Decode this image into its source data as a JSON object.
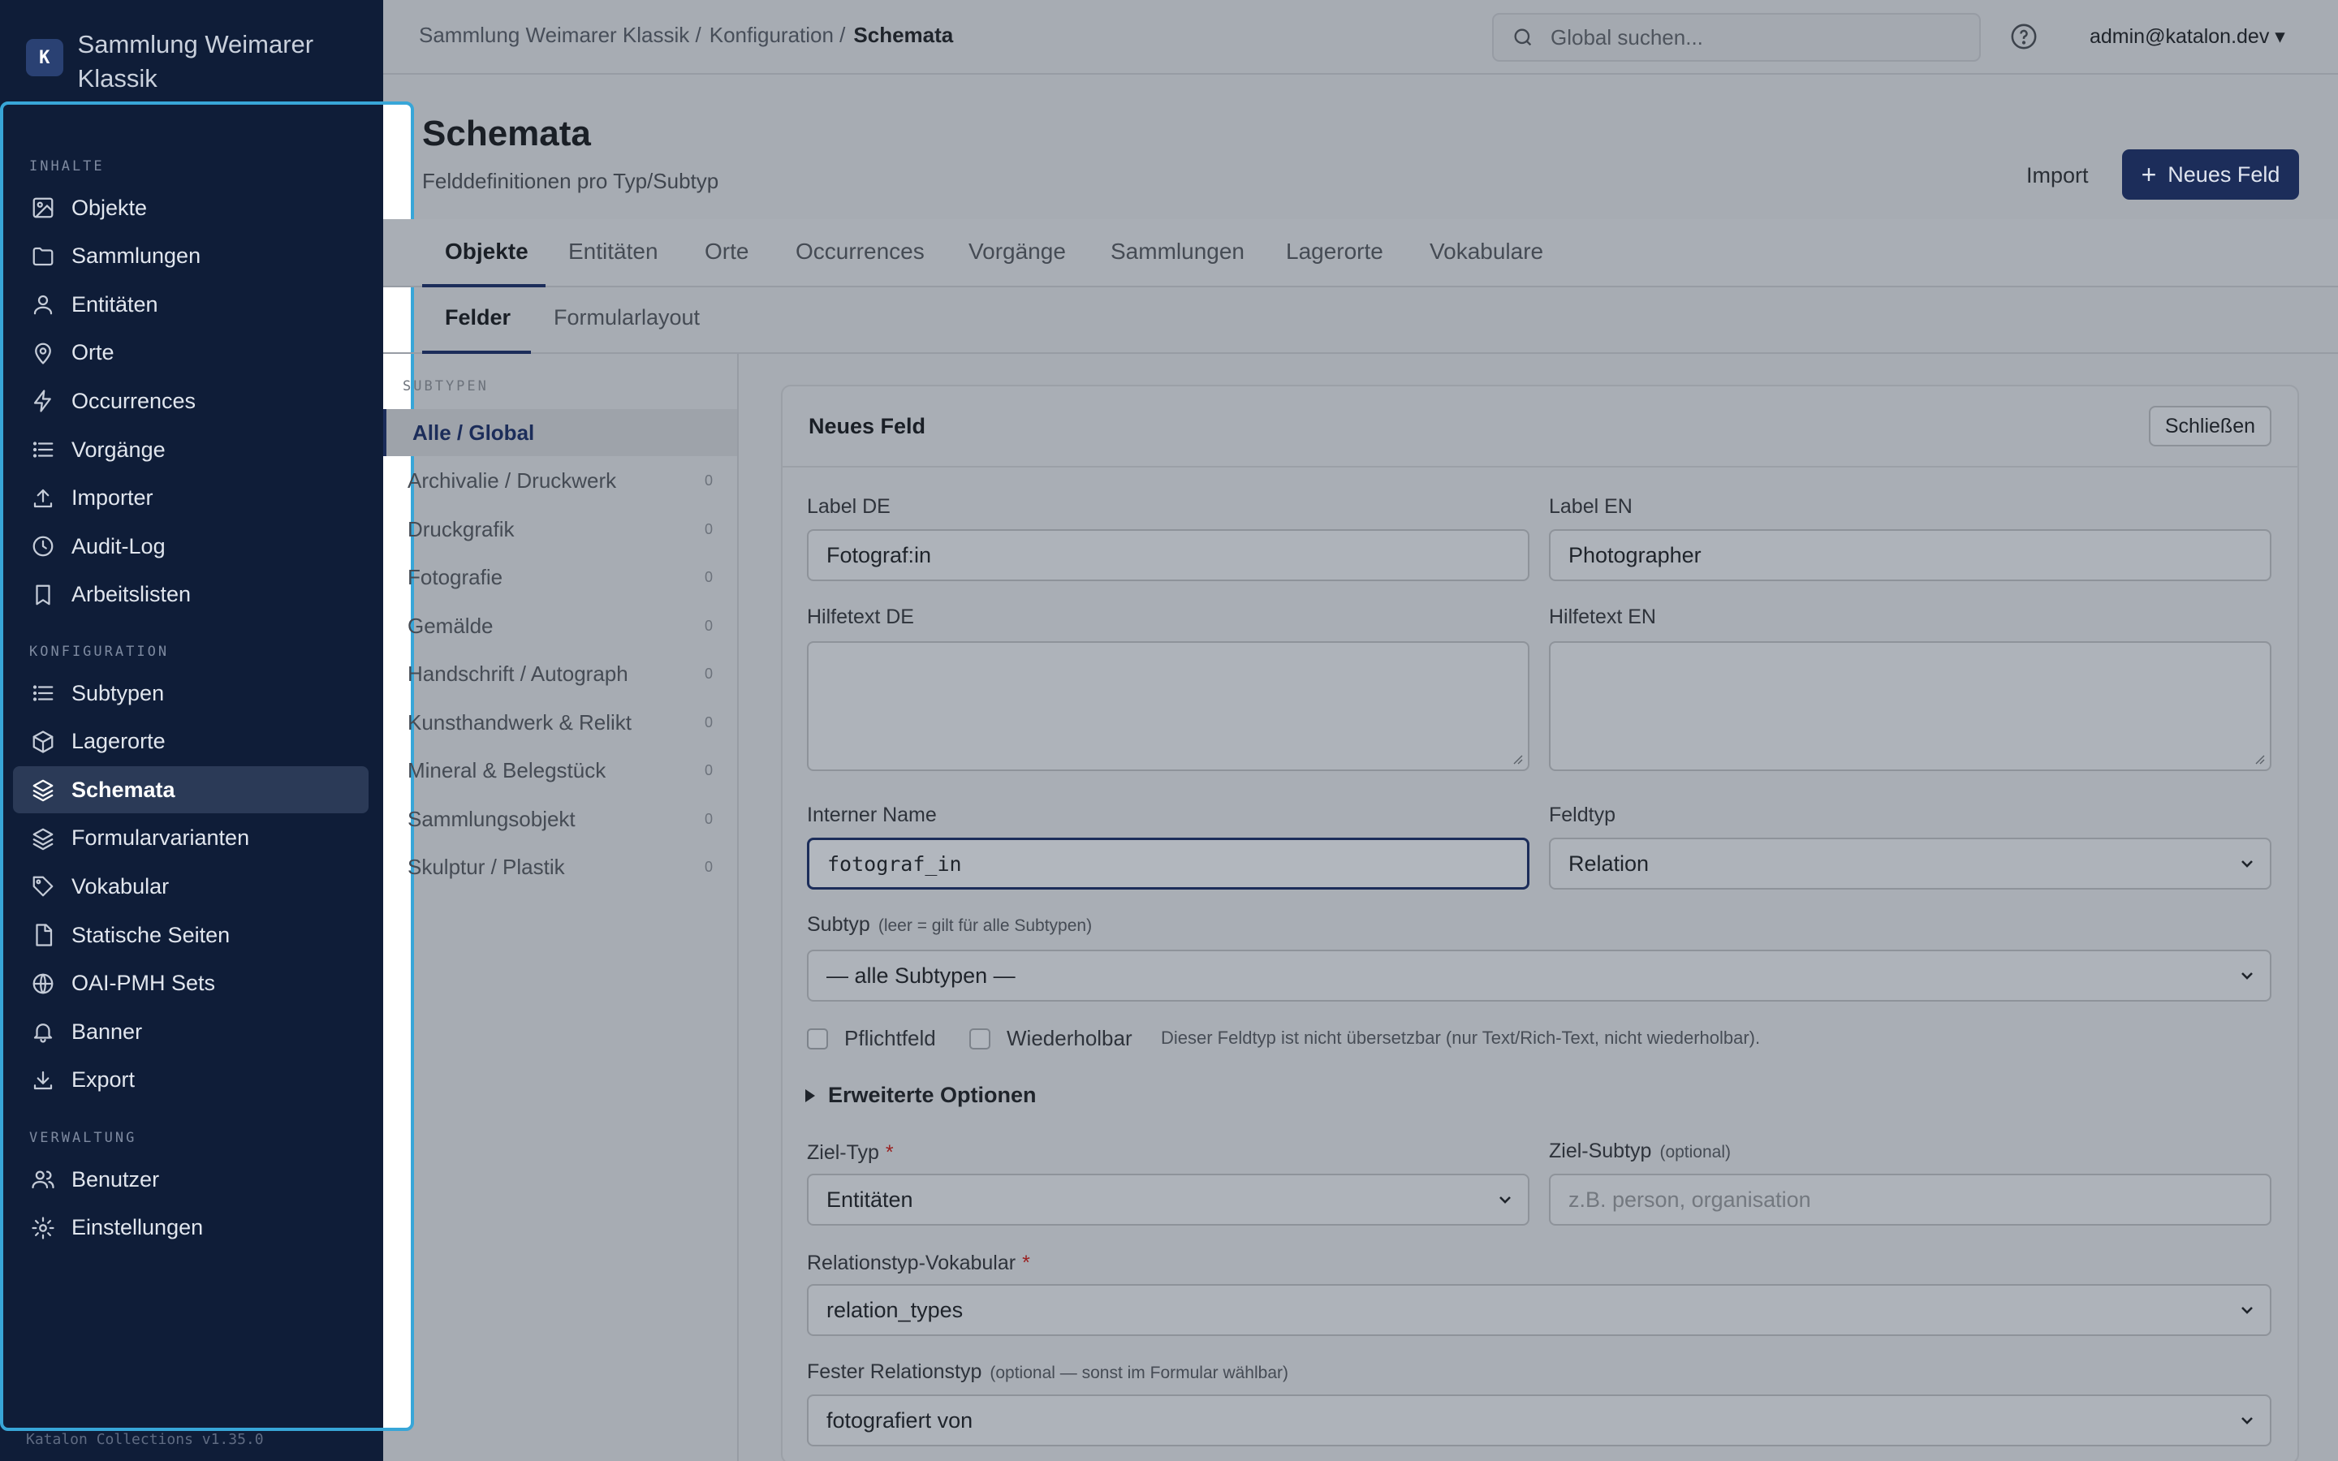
{
  "sidebar": {
    "brand": {
      "logo_letter": "K",
      "name": "Sammlung Weimarer Klassik"
    },
    "sections": [
      {
        "label": "INHALTE",
        "items": [
          {
            "label": "Objekte",
            "icon": "image-icon"
          },
          {
            "label": "Sammlungen",
            "icon": "folder-icon"
          },
          {
            "label": "Entitäten",
            "icon": "user-icon"
          },
          {
            "label": "Orte",
            "icon": "map-pin-icon"
          },
          {
            "label": "Occurrences",
            "icon": "lightning-icon"
          },
          {
            "label": "Vorgänge",
            "icon": "list-icon"
          },
          {
            "label": "Importer",
            "icon": "upload-icon"
          },
          {
            "label": "Audit-Log",
            "icon": "clock-icon"
          },
          {
            "label": "Arbeitslisten",
            "icon": "bookmark-icon"
          }
        ]
      },
      {
        "label": "KONFIGURATION",
        "items": [
          {
            "label": "Subtypen",
            "icon": "list-icon"
          },
          {
            "label": "Lagerorte",
            "icon": "box-icon"
          },
          {
            "label": "Schemata",
            "icon": "layers-icon",
            "active": true
          },
          {
            "label": "Formularvarianten",
            "icon": "layers-icon"
          },
          {
            "label": "Vokabular",
            "icon": "tag-icon"
          },
          {
            "label": "Statische Seiten",
            "icon": "file-icon"
          },
          {
            "label": "OAI-PMH Sets",
            "icon": "globe-icon"
          },
          {
            "label": "Banner",
            "icon": "bell-icon"
          },
          {
            "label": "Export",
            "icon": "download-icon"
          }
        ]
      },
      {
        "label": "VERWALTUNG",
        "items": [
          {
            "label": "Benutzer",
            "icon": "users-icon"
          },
          {
            "label": "Einstellungen",
            "icon": "gear-icon"
          }
        ]
      }
    ],
    "version": "Katalon Collections v1.35.0"
  },
  "topbar": {
    "breadcrumb": [
      "Sammlung Weimarer Klassik /",
      "Konfiguration /",
      "Schemata"
    ],
    "search_placeholder": "Global suchen...",
    "user": "admin@katalon.dev ▾"
  },
  "header": {
    "title": "Schemata",
    "subtitle": "Felddefinitionen pro Typ/Subtyp",
    "import_label": "Import",
    "new_field_label": "Neues Feld"
  },
  "tabs": [
    "Objekte",
    "Entitäten",
    "Orte",
    "Occurrences",
    "Vorgänge",
    "Sammlungen",
    "Lagerorte",
    "Vokabulare"
  ],
  "subtabs": [
    "Felder",
    "Formularlayout"
  ],
  "subtypes": {
    "label": "SUBTYPEN",
    "items": [
      {
        "name": "Alle / Global",
        "count": ""
      },
      {
        "name": "Archivalie / Druckwerk",
        "count": "0"
      },
      {
        "name": "Druckgrafik",
        "count": "0"
      },
      {
        "name": "Fotografie",
        "count": "0"
      },
      {
        "name": "Gemälde",
        "count": "0"
      },
      {
        "name": "Handschrift / Autograph",
        "count": "0"
      },
      {
        "name": "Kunsthandwerk & Relikt",
        "count": "0"
      },
      {
        "name": "Mineral & Belegstück",
        "count": "0"
      },
      {
        "name": "Sammlungsobjekt",
        "count": "0"
      },
      {
        "name": "Skulptur / Plastik",
        "count": "0"
      }
    ]
  },
  "form": {
    "title": "Neues Feld",
    "close_label": "Schließen",
    "label_de": {
      "label": "Label DE",
      "value": "Fotograf:in"
    },
    "label_en": {
      "label": "Label EN",
      "value": "Photographer"
    },
    "help_de": {
      "label": "Hilfetext DE",
      "value": ""
    },
    "help_en": {
      "label": "Hilfetext EN",
      "value": ""
    },
    "internal_name": {
      "label": "Interner Name",
      "value": "fotograf_in"
    },
    "field_type": {
      "label": "Feldtyp",
      "value": "Relation"
    },
    "subtype": {
      "label": "Subtyp",
      "hint": "(leer = gilt für alle Subtypen)",
      "value": "— alle Subtypen —"
    },
    "required_label": "Pflichtfeld",
    "repeatable_label": "Wiederholbar",
    "note": "Dieser Feldtyp ist nicht übersetzbar (nur Text/Rich-Text, nicht wiederholbar).",
    "advanced_label": "Erweiterte Optionen",
    "target_type": {
      "label": "Ziel-Typ",
      "required": "*",
      "value": "Entitäten"
    },
    "target_subtype": {
      "label": "Ziel-Subtyp",
      "hint": "(optional)",
      "placeholder": "z.B. person, organisation"
    },
    "relation_vocab": {
      "label": "Relationstyp-Vokabular",
      "required": "*",
      "value": "relation_types"
    },
    "fixed_relation": {
      "label": "Fester Relationstyp",
      "hint": "(optional — sonst im Formular wählbar)",
      "value": "fotografiert von"
    }
  },
  "colors": {
    "sidebar_bg": "#0f1d38",
    "accent": "#1c2d5a",
    "highlight": "#38a6d8"
  }
}
